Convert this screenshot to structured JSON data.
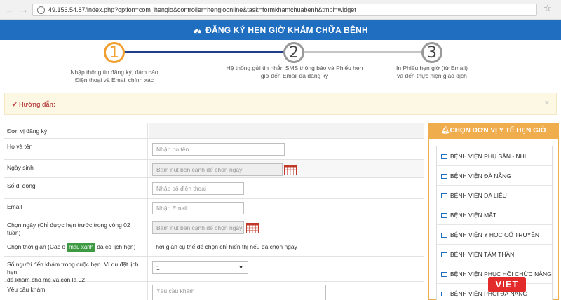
{
  "browser": {
    "url": "49.156.54.87/index.php?option=com_hengio&controller=hengioonline&task=formkhamchuabenh&tmpl=widget",
    "back": "←",
    "forward": "→",
    "reload": "↻",
    "star": "☆"
  },
  "header": {
    "title": "ĐĂNG KÝ HẸN GIỜ KHÁM CHỮA BỆNH"
  },
  "steps": [
    {
      "number": "1",
      "label_line1": "Nhập thông tin đăng ký, đảm bảo",
      "label_line2": "Điện thoại và Email chính xác",
      "active": true
    },
    {
      "number": "2",
      "label_line1": "Hệ thống gửi tin nhắn SMS thông báo và Phiếu hẹn",
      "label_line2": "giờ đến Email đã đăng ký",
      "active": false
    },
    {
      "number": "3",
      "label_line1": "In Phiếu hẹn giờ (từ Email)",
      "label_line2": "và đến thực hiện giao dịch",
      "active": false
    }
  ],
  "alert": {
    "text": "Hướng dẫn:",
    "close": "×"
  },
  "form": {
    "unit": {
      "label": "Đơn vị đăng ký"
    },
    "name": {
      "label": "Họ và tên",
      "placeholder": "Nhập họ tên"
    },
    "dob": {
      "label": "Ngày sinh",
      "placeholder": "Bấm nút bên cạnh để chọn ngày"
    },
    "phone": {
      "label": "Số di động",
      "placeholder": "Nhập số điện thoại"
    },
    "email": {
      "label": "Email",
      "placeholder": "Nhập Email"
    },
    "date": {
      "label": "Chọn ngày (Chỉ được hẹn trước trong vòng 02 tuần)",
      "placeholder": "Bấm nút bên cạnh để chọn ngày"
    },
    "time": {
      "label_pre": "Chọn thời gian (Các ô",
      "badge": "màu xanh",
      "label_post": "đã có lịch hẹn)",
      "note": "Thời gian cụ thể để chọn chỉ hiển thị nếu đã chọn ngày"
    },
    "people": {
      "label_line1": "Số người đến khám trong cuộc hẹn. Ví dụ đặt lịch hẹn",
      "label_line2": "để khám cho mẹ và con là 02",
      "value": "1"
    },
    "request": {
      "label": "Yêu cầu khám",
      "placeholder": "Yêu cầu khám"
    }
  },
  "panel": {
    "title": "CHỌN ĐƠN VỊ Y TẾ HẸN GIỜ",
    "hospitals": [
      "BỆNH VIỆN PHỤ SẢN - NHI",
      "BỆNH VIỆN ĐÀ NẴNG",
      "BỆNH VIỆN DA LIỄU",
      "BỆNH VIỆN MẮT",
      "BỆNH VIỆN Y HỌC CỔ TRUYỀN",
      "BỆNH VIỆN TÂM THẦN",
      "BỆNH VIỆN PHỤC HỒI CHỨC NĂNG",
      "BỆNH VIỆN PHỔI ĐÀ NẴNG"
    ]
  },
  "logo": {
    "text": "VIET"
  },
  "colors": {
    "header_blue": "#1f6ec0",
    "step_orange": "#f0a030",
    "panel_orange": "#f0ad4e",
    "badge_green": "#3d9a43",
    "logo_red": "#e32b2b"
  }
}
